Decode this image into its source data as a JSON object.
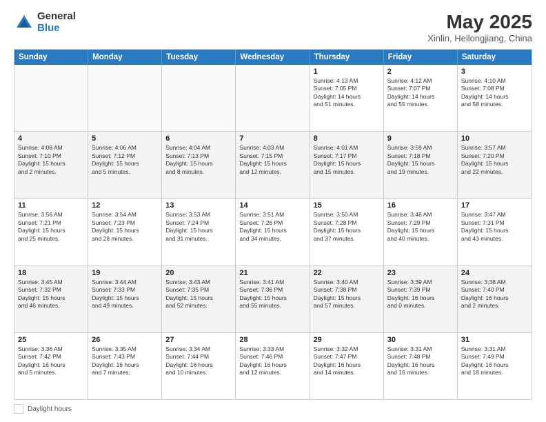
{
  "logo": {
    "general": "General",
    "blue": "Blue"
  },
  "header": {
    "month": "May 2025",
    "location": "Xinlin, Heilongjiang, China"
  },
  "weekdays": [
    "Sunday",
    "Monday",
    "Tuesday",
    "Wednesday",
    "Thursday",
    "Friday",
    "Saturday"
  ],
  "legend": {
    "label": "Daylight hours"
  },
  "weeks": [
    [
      {
        "num": "",
        "info": "",
        "empty": true
      },
      {
        "num": "",
        "info": "",
        "empty": true
      },
      {
        "num": "",
        "info": "",
        "empty": true
      },
      {
        "num": "",
        "info": "",
        "empty": true
      },
      {
        "num": "1",
        "info": "Sunrise: 4:13 AM\nSunset: 7:05 PM\nDaylight: 14 hours\nand 51 minutes.",
        "empty": false
      },
      {
        "num": "2",
        "info": "Sunrise: 4:12 AM\nSunset: 7:07 PM\nDaylight: 14 hours\nand 55 minutes.",
        "empty": false
      },
      {
        "num": "3",
        "info": "Sunrise: 4:10 AM\nSunset: 7:08 PM\nDaylight: 14 hours\nand 58 minutes.",
        "empty": false
      }
    ],
    [
      {
        "num": "4",
        "info": "Sunrise: 4:08 AM\nSunset: 7:10 PM\nDaylight: 15 hours\nand 2 minutes.",
        "empty": false
      },
      {
        "num": "5",
        "info": "Sunrise: 4:06 AM\nSunset: 7:12 PM\nDaylight: 15 hours\nand 5 minutes.",
        "empty": false
      },
      {
        "num": "6",
        "info": "Sunrise: 4:04 AM\nSunset: 7:13 PM\nDaylight: 15 hours\nand 8 minutes.",
        "empty": false
      },
      {
        "num": "7",
        "info": "Sunrise: 4:03 AM\nSunset: 7:15 PM\nDaylight: 15 hours\nand 12 minutes.",
        "empty": false
      },
      {
        "num": "8",
        "info": "Sunrise: 4:01 AM\nSunset: 7:17 PM\nDaylight: 15 hours\nand 15 minutes.",
        "empty": false
      },
      {
        "num": "9",
        "info": "Sunrise: 3:59 AM\nSunset: 7:18 PM\nDaylight: 15 hours\nand 19 minutes.",
        "empty": false
      },
      {
        "num": "10",
        "info": "Sunrise: 3:57 AM\nSunset: 7:20 PM\nDaylight: 15 hours\nand 22 minutes.",
        "empty": false
      }
    ],
    [
      {
        "num": "11",
        "info": "Sunrise: 3:56 AM\nSunset: 7:21 PM\nDaylight: 15 hours\nand 25 minutes.",
        "empty": false
      },
      {
        "num": "12",
        "info": "Sunrise: 3:54 AM\nSunset: 7:23 PM\nDaylight: 15 hours\nand 28 minutes.",
        "empty": false
      },
      {
        "num": "13",
        "info": "Sunrise: 3:53 AM\nSunset: 7:24 PM\nDaylight: 15 hours\nand 31 minutes.",
        "empty": false
      },
      {
        "num": "14",
        "info": "Sunrise: 3:51 AM\nSunset: 7:26 PM\nDaylight: 15 hours\nand 34 minutes.",
        "empty": false
      },
      {
        "num": "15",
        "info": "Sunrise: 3:50 AM\nSunset: 7:28 PM\nDaylight: 15 hours\nand 37 minutes.",
        "empty": false
      },
      {
        "num": "16",
        "info": "Sunrise: 3:48 AM\nSunset: 7:29 PM\nDaylight: 15 hours\nand 40 minutes.",
        "empty": false
      },
      {
        "num": "17",
        "info": "Sunrise: 3:47 AM\nSunset: 7:31 PM\nDaylight: 15 hours\nand 43 minutes.",
        "empty": false
      }
    ],
    [
      {
        "num": "18",
        "info": "Sunrise: 3:45 AM\nSunset: 7:32 PM\nDaylight: 15 hours\nand 46 minutes.",
        "empty": false
      },
      {
        "num": "19",
        "info": "Sunrise: 3:44 AM\nSunset: 7:33 PM\nDaylight: 15 hours\nand 49 minutes.",
        "empty": false
      },
      {
        "num": "20",
        "info": "Sunrise: 3:43 AM\nSunset: 7:35 PM\nDaylight: 15 hours\nand 52 minutes.",
        "empty": false
      },
      {
        "num": "21",
        "info": "Sunrise: 3:41 AM\nSunset: 7:36 PM\nDaylight: 15 hours\nand 55 minutes.",
        "empty": false
      },
      {
        "num": "22",
        "info": "Sunrise: 3:40 AM\nSunset: 7:38 PM\nDaylight: 15 hours\nand 57 minutes.",
        "empty": false
      },
      {
        "num": "23",
        "info": "Sunrise: 3:39 AM\nSunset: 7:39 PM\nDaylight: 16 hours\nand 0 minutes.",
        "empty": false
      },
      {
        "num": "24",
        "info": "Sunrise: 3:38 AM\nSunset: 7:40 PM\nDaylight: 16 hours\nand 2 minutes.",
        "empty": false
      }
    ],
    [
      {
        "num": "25",
        "info": "Sunrise: 3:36 AM\nSunset: 7:42 PM\nDaylight: 16 hours\nand 5 minutes.",
        "empty": false
      },
      {
        "num": "26",
        "info": "Sunrise: 3:35 AM\nSunset: 7:43 PM\nDaylight: 16 hours\nand 7 minutes.",
        "empty": false
      },
      {
        "num": "27",
        "info": "Sunrise: 3:34 AM\nSunset: 7:44 PM\nDaylight: 16 hours\nand 10 minutes.",
        "empty": false
      },
      {
        "num": "28",
        "info": "Sunrise: 3:33 AM\nSunset: 7:46 PM\nDaylight: 16 hours\nand 12 minutes.",
        "empty": false
      },
      {
        "num": "29",
        "info": "Sunrise: 3:32 AM\nSunset: 7:47 PM\nDaylight: 16 hours\nand 14 minutes.",
        "empty": false
      },
      {
        "num": "30",
        "info": "Sunrise: 3:31 AM\nSunset: 7:48 PM\nDaylight: 16 hours\nand 16 minutes.",
        "empty": false
      },
      {
        "num": "31",
        "info": "Sunrise: 3:31 AM\nSunset: 7:49 PM\nDaylight: 16 hours\nand 18 minutes.",
        "empty": false
      }
    ]
  ]
}
